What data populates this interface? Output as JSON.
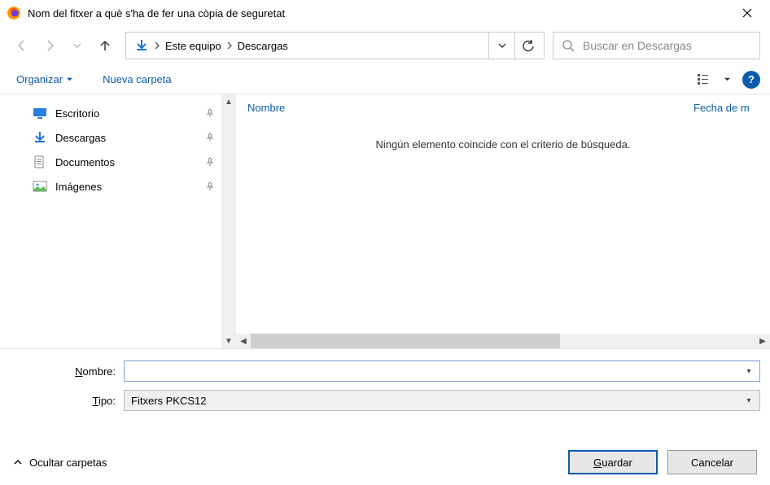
{
  "title": "Nom del fitxer a què s'ha de fer una còpia de seguretat",
  "breadcrumb": {
    "root": "Este equipo",
    "child": "Descargas"
  },
  "search": {
    "placeholder": "Buscar en Descargas"
  },
  "toolbar": {
    "organize": "Organizar",
    "new_folder": "Nueva carpeta"
  },
  "sidebar": {
    "items": [
      {
        "label": "Escritorio"
      },
      {
        "label": "Descargas"
      },
      {
        "label": "Documentos"
      },
      {
        "label": "Imágenes"
      }
    ]
  },
  "content": {
    "col_name": "Nombre",
    "col_date": "Fecha de m",
    "empty_text": "Ningún elemento coincide con el criterio de búsqueda."
  },
  "fields": {
    "name_label_pre": "",
    "name_label_ul": "N",
    "name_label_post": "ombre:",
    "name_value": "",
    "type_label_pre": "",
    "type_label_ul": "T",
    "type_label_post": "ipo:",
    "type_value": "Fitxers PKCS12"
  },
  "footer": {
    "hide_folders": "Ocultar carpetas",
    "save_ul": "G",
    "save_post": "uardar",
    "cancel": "Cancelar"
  }
}
